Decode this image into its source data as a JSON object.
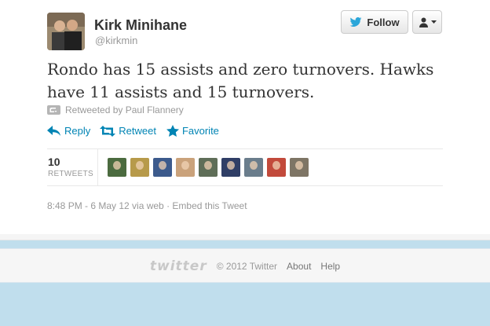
{
  "author": {
    "name": "Kirk Minihane",
    "handle": "@kirkmin"
  },
  "buttons": {
    "follow_label": "Follow"
  },
  "tweet": {
    "text": "Rondo has 15 assists and zero turnovers. Hawks have 11 assists and 15 turnovers.",
    "retweeted_by": "Retweeted by Paul Flannery"
  },
  "actions": {
    "reply": "Reply",
    "retweet": "Retweet",
    "favorite": "Favorite"
  },
  "stats": {
    "retweet_count": "10",
    "retweet_label": "RETWEETS"
  },
  "retweeter_avatars": [
    {
      "color": "#4b6b3f"
    },
    {
      "color": "#b79a4a"
    },
    {
      "color": "#3c5a8c"
    },
    {
      "color": "#caa27b"
    },
    {
      "color": "#5f6e58"
    },
    {
      "color": "#2f3e66"
    },
    {
      "color": "#6a7d8c"
    },
    {
      "color": "#c24a3b"
    },
    {
      "color": "#7e7565"
    }
  ],
  "meta": {
    "timestamp": "8:48 PM - 6 May 12 via web",
    "separator": " · ",
    "embed": "Embed this Tweet"
  },
  "footer": {
    "logo": "twitter",
    "copyright": "© 2012 Twitter",
    "about": "About",
    "help": "Help"
  },
  "colors": {
    "link": "#0084b4",
    "page_background": "#c0deed"
  }
}
